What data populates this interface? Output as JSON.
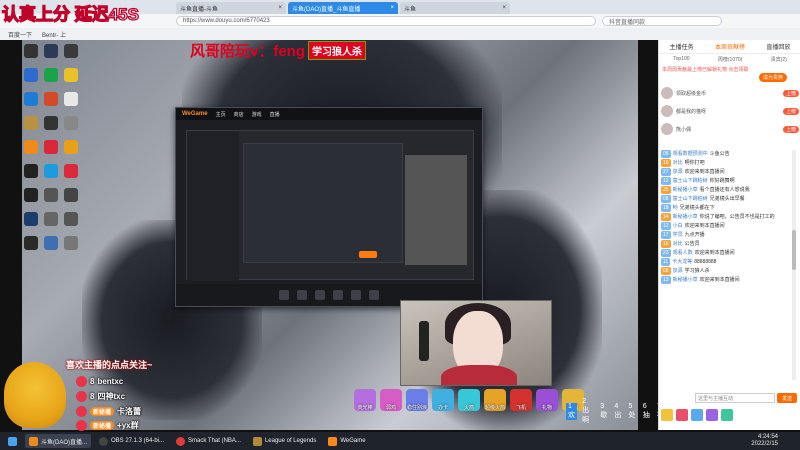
{
  "overlay": {
    "lag_text": "认真上分 延迟45S",
    "companion_text": "风哥陪玩v：feng",
    "companion_box": "学习狼人杀"
  },
  "browser": {
    "tabs": [
      {
        "label": "斗鱼直播-斗鱼",
        "active": false
      },
      {
        "label": "斗鱼(DAO)直播_斗鱼直播",
        "active": true
      },
      {
        "label": "斗鱼",
        "active": false
      }
    ],
    "address": "https://www.douyu.com/6770423",
    "search_placeholder": "抖音直播同款",
    "favorites": [
      "百度一下",
      "Bentr- 上"
    ]
  },
  "wegame": {
    "logo": "WeGame",
    "nav": [
      "主页",
      "商店",
      "游戏",
      "直播"
    ]
  },
  "viewers": {
    "welcome": "喜欢主播的点点关注~",
    "rows": [
      {
        "tag": "8",
        "name": "bentxc"
      },
      {
        "tag": "8",
        "name": "四神txc"
      },
      {
        "tag": "新秘播",
        "name": "卡洛蕾"
      },
      {
        "tag": "新秘播",
        "name": "+yx群"
      }
    ]
  },
  "gifts": {
    "items": [
      "荧光棒",
      "弱鸡",
      "稳住别浪",
      "办卡",
      "火箭",
      "超级火箭",
      "飞机",
      "礼物",
      "宝箱"
    ],
    "numbers": [
      "1 欢",
      "2 出啊",
      "3 歇",
      "4 出",
      "5 处",
      "6 抽",
      "7 初"
    ]
  },
  "sidebar": {
    "tabs": [
      "主播任务",
      "本周贡献榜",
      "直播回放"
    ],
    "subtabs": [
      "Top100",
      "周榜(1070)",
      "贵宾(2)"
    ],
    "notice": "本周周贡献最上榜已解锁礼物 点击领取",
    "rank_button": "成为贵族",
    "ranks": [
      {
        "name": "领取超级金币",
        "badge": "上榜"
      },
      {
        "name": "都是我的猫呀",
        "badge": "上榜"
      },
      {
        "name": "熊小偶",
        "badge": "上榜"
      }
    ],
    "chat": [
      {
        "lv": "08",
        "name": "观看数据预测中",
        "text": "斗鱼公告"
      },
      {
        "lv": "16",
        "name": "对比",
        "text": "啊你打吧"
      },
      {
        "lv": "27",
        "name": "泉源",
        "text": "欢迎来到本直播间"
      },
      {
        "lv": "12",
        "name": "富士山下跳柏树",
        "text": "你好跳舞啊"
      },
      {
        "lv": "25",
        "name": "新秘播小草",
        "text": "看个直播还有人想说我"
      },
      {
        "lv": "08",
        "name": "富士山下跳柏树",
        "text": "兄弟镜头出早餐"
      },
      {
        "lv": "18",
        "name": "哟",
        "text": "兄弟镜头都在下"
      },
      {
        "lv": "14",
        "name": "新秘播小草",
        "text": "你说了编吧，公告员不也是打工的"
      },
      {
        "lv": "12",
        "name": "小白",
        "text": "欢迎来到本直播间"
      },
      {
        "lv": "17",
        "name": "学员",
        "text": "九点开播"
      },
      {
        "lv": "16",
        "name": "对比",
        "text": "公告员"
      },
      {
        "lv": "23",
        "name": "观看人数",
        "text": "欢迎来到本直播间"
      },
      {
        "lv": "11",
        "name": "卡大龙等",
        "text": "88888888"
      },
      {
        "lv": "08",
        "name": "泉源",
        "text": "学习狼人杀"
      },
      {
        "lv": "13",
        "name": "新秘播小草",
        "text": "欢迎来到本直播间"
      }
    ],
    "input_placeholder": "这里与主播互动",
    "send_label": "发送"
  },
  "taskbar": {
    "items": [
      "斗鱼(DAO)直播...",
      "OBS 27.1.3 (64-bi...",
      "Smack That (NBA...",
      "League of Legends",
      "WeGame"
    ],
    "time": "4:24:54",
    "date": "2022/2/15"
  }
}
